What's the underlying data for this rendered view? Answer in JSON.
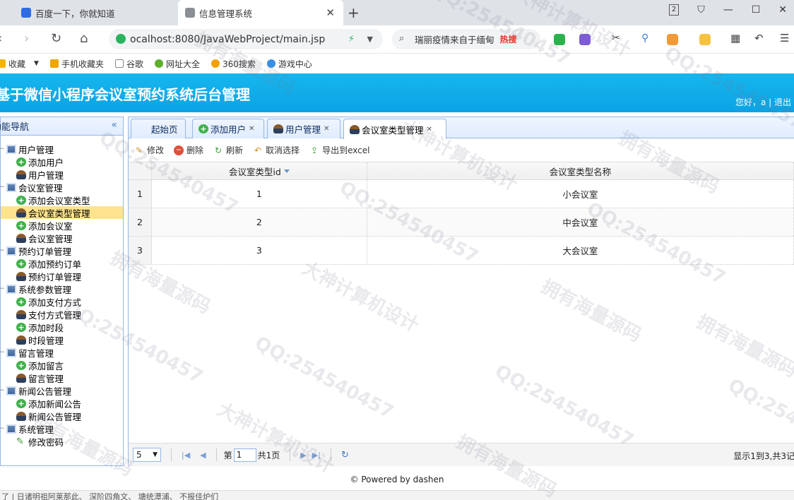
{
  "browser": {
    "tabs": [
      {
        "title": "百度一下，你就知道"
      },
      {
        "title": "信息管理系统"
      }
    ],
    "url": "ocalhost:8080/JavaWebProject/main.jsp",
    "search_text": "瑞丽疫情来自于缅甸",
    "search_hot": "热搜",
    "window_badge": "2"
  },
  "bookmarks": [
    "收藏",
    "手机收藏夹",
    "谷歌",
    "网址大全",
    "360搜索",
    "游戏中心"
  ],
  "app": {
    "title": "基于微信小程序会议室预约系统后台管理",
    "greeting": "您好，a | 退出"
  },
  "nav": {
    "title": "功能导航",
    "groups": [
      {
        "label": "用户管理",
        "items": [
          "添加用户",
          "用户管理"
        ]
      },
      {
        "label": "会议室管理",
        "items": [
          "添加会议室类型",
          "会议室类型管理",
          "添加会议室",
          "会议室管理"
        ]
      },
      {
        "label": "预约订单管理",
        "items": [
          "添加预约订单",
          "预约订单管理"
        ]
      },
      {
        "label": "系统参数管理",
        "items": [
          "添加支付方式",
          "支付方式管理",
          "添加时段",
          "时段管理"
        ]
      },
      {
        "label": "留言管理",
        "items": [
          "添加留言",
          "留言管理"
        ]
      },
      {
        "label": "新闻公告管理",
        "items": [
          "添加新闻公告",
          "新闻公告管理"
        ]
      },
      {
        "label": "系统管理",
        "items": [
          "修改密码"
        ]
      }
    ],
    "selected": "会议室类型管理"
  },
  "panel_tabs": [
    {
      "label": "起始页"
    },
    {
      "label": "添加用户"
    },
    {
      "label": "用户管理"
    },
    {
      "label": "会议室类型管理"
    }
  ],
  "toolbar": {
    "edit": "修改",
    "delete": "删除",
    "refresh": "刷新",
    "unselect": "取消选择",
    "export": "导出到excel"
  },
  "grid": {
    "columns": [
      "会议室类型id",
      "会议室类型名称"
    ],
    "rows": [
      {
        "n": "1",
        "id": "1",
        "name": "小会议室"
      },
      {
        "n": "2",
        "id": "2",
        "name": "中会议室"
      },
      {
        "n": "3",
        "id": "3",
        "name": "大会议室"
      }
    ]
  },
  "pager": {
    "page_size": "5",
    "page_prefix": "第",
    "page_value": "1",
    "page_suffix": "共1页",
    "info": "显示1到3,共3记"
  },
  "footer": "© Powered by dashen",
  "statusbar": "了 | 日诸明祖阿莱那此、 深阶四角文、 塘统潭浦、 不报佳炉们 ",
  "watermarks": [
    "QQ:254540457",
    "大神计算机设计",
    "拥有海量源码"
  ]
}
